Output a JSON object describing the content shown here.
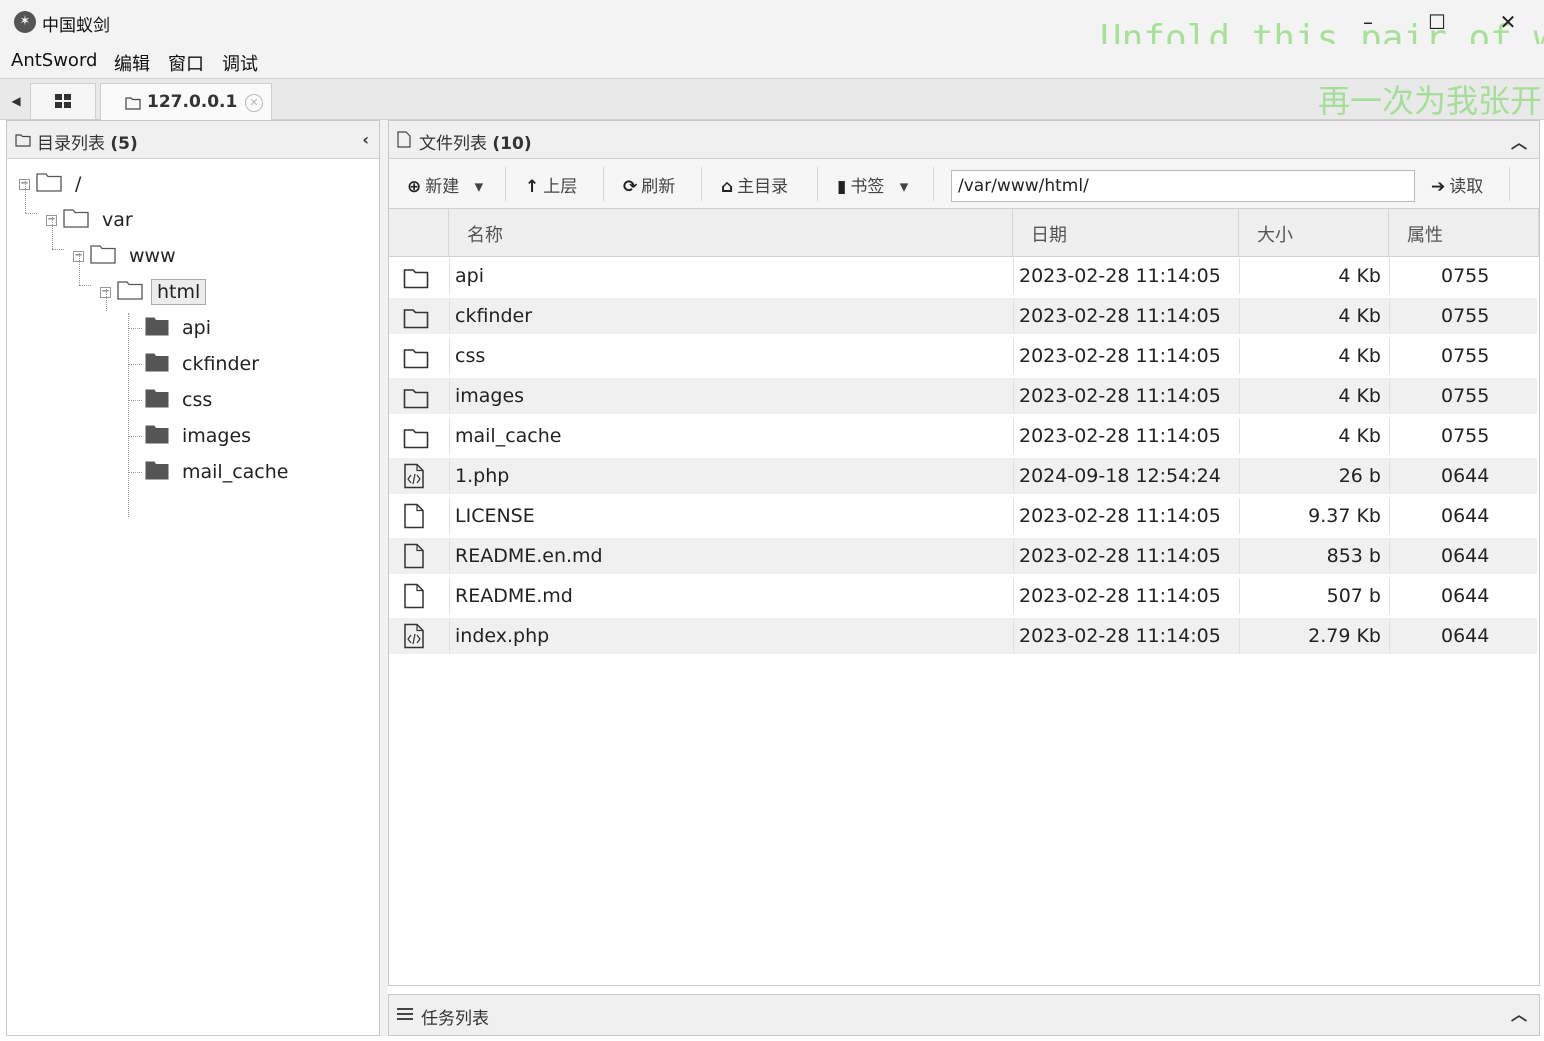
{
  "window": {
    "title": "中国蚁剑",
    "deco_line1": "Unfold this pair of w",
    "deco_line2": "再一次为我张开"
  },
  "menu": [
    "AntSword",
    "编辑",
    "窗口",
    "调试"
  ],
  "tabs": {
    "active_label": "127.0.0.1"
  },
  "left_panel": {
    "title": "目录列表",
    "count": "(5)",
    "tree": [
      {
        "label": "/",
        "depth": 0,
        "kind": "folder-open"
      },
      {
        "label": "var",
        "depth": 1,
        "kind": "folder-open"
      },
      {
        "label": "www",
        "depth": 2,
        "kind": "folder-open"
      },
      {
        "label": "html",
        "depth": 3,
        "kind": "folder-open",
        "selected": true
      },
      {
        "label": "api",
        "depth": 4,
        "kind": "folder"
      },
      {
        "label": "ckfinder",
        "depth": 4,
        "kind": "folder"
      },
      {
        "label": "css",
        "depth": 4,
        "kind": "folder"
      },
      {
        "label": "images",
        "depth": 4,
        "kind": "folder"
      },
      {
        "label": "mail_cache",
        "depth": 4,
        "kind": "folder"
      }
    ]
  },
  "right_panel": {
    "title": "文件列表",
    "count": "(10)",
    "toolbar": {
      "new_label": "新建",
      "up_label": "上层",
      "refresh_label": "刷新",
      "home_label": "主目录",
      "bookmark_label": "书签",
      "path_value": "/var/www/html/",
      "read_label": "读取"
    },
    "columns": [
      "名称",
      "日期",
      "大小",
      "属性"
    ],
    "files": [
      {
        "icon": "folder",
        "name": "api",
        "date": "2023-02-28 11:14:05",
        "size": "4 Kb",
        "attr": "0755"
      },
      {
        "icon": "folder",
        "name": "ckfinder",
        "date": "2023-02-28 11:14:05",
        "size": "4 Kb",
        "attr": "0755"
      },
      {
        "icon": "folder",
        "name": "css",
        "date": "2023-02-28 11:14:05",
        "size": "4 Kb",
        "attr": "0755"
      },
      {
        "icon": "folder",
        "name": "images",
        "date": "2023-02-28 11:14:05",
        "size": "4 Kb",
        "attr": "0755"
      },
      {
        "icon": "folder",
        "name": "mail_cache",
        "date": "2023-02-28 11:14:05",
        "size": "4 Kb",
        "attr": "0755"
      },
      {
        "icon": "code-file",
        "name": "1.php",
        "date": "2024-09-18 12:54:24",
        "size": "26 b",
        "attr": "0644"
      },
      {
        "icon": "file",
        "name": "LICENSE",
        "date": "2023-02-28 11:14:05",
        "size": "9.37 Kb",
        "attr": "0644"
      },
      {
        "icon": "file",
        "name": "README.en.md",
        "date": "2023-02-28 11:14:05",
        "size": "853 b",
        "attr": "0644"
      },
      {
        "icon": "file",
        "name": "README.md",
        "date": "2023-02-28 11:14:05",
        "size": "507 b",
        "attr": "0644"
      },
      {
        "icon": "code-file",
        "name": "index.php",
        "date": "2023-02-28 11:14:05",
        "size": "2.79 Kb",
        "attr": "0644"
      }
    ]
  },
  "task_panel": {
    "title": "任务列表"
  }
}
